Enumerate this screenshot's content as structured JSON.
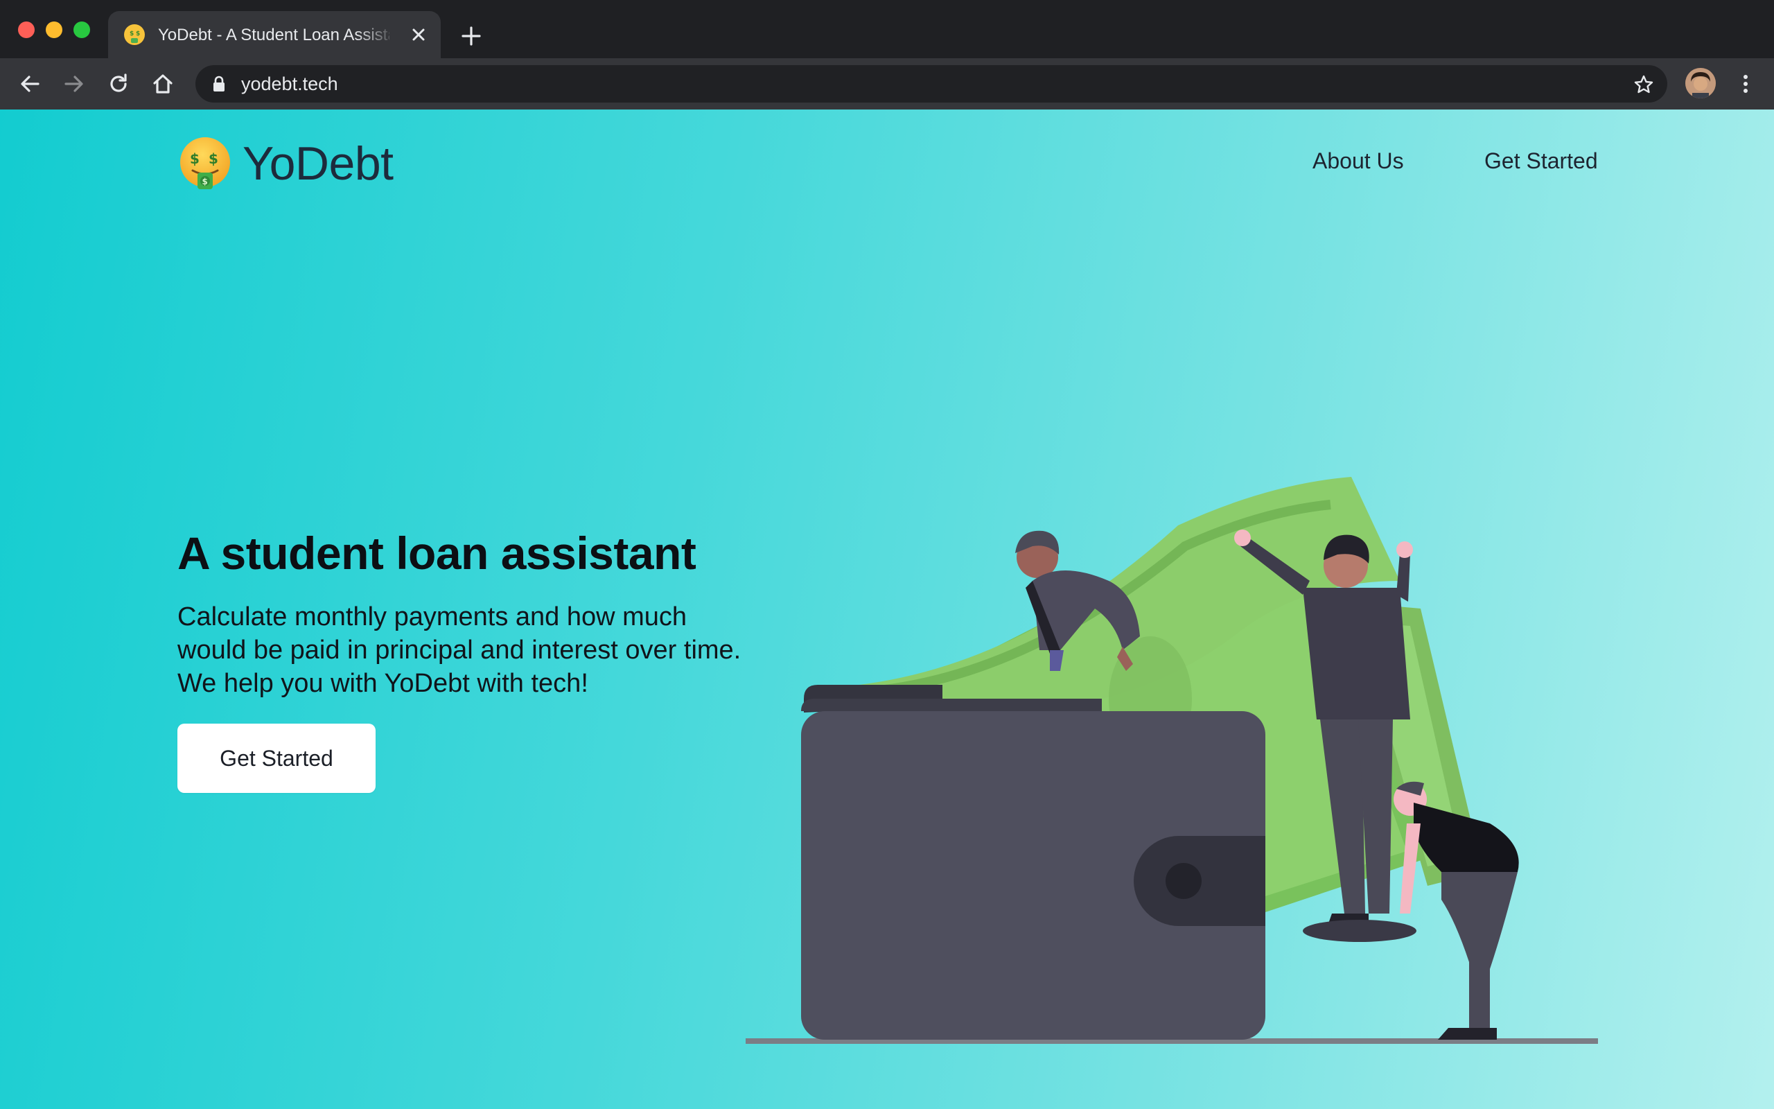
{
  "browser": {
    "tab_title": "YoDebt - A Student Loan Assistant",
    "url": "yodebt.tech",
    "favicon_icon": "money-mouth-face-icon",
    "colors": {
      "chrome_dark": "#1f2023",
      "chrome_mid": "#35363a"
    }
  },
  "site": {
    "brand_emoji_icon": "money-mouth-face-icon",
    "brand_name": "YoDebt",
    "nav": [
      {
        "label": "About Us"
      },
      {
        "label": "Get Started"
      }
    ],
    "hero": {
      "title": "A student loan assistant",
      "subtitle": "Calculate monthly payments and how much would be paid in principal and interest over time. We help you with YoDebt with tech!",
      "cta_label": "Get Started"
    },
    "illustration_icon": "wallet-money-people-illustration",
    "colors": {
      "gradient_start": "#13ccd0",
      "gradient_end": "#b3f0ee",
      "text": "#0c0f14",
      "wallet": "#4f4f5e",
      "money": "#8dcf6a"
    }
  }
}
